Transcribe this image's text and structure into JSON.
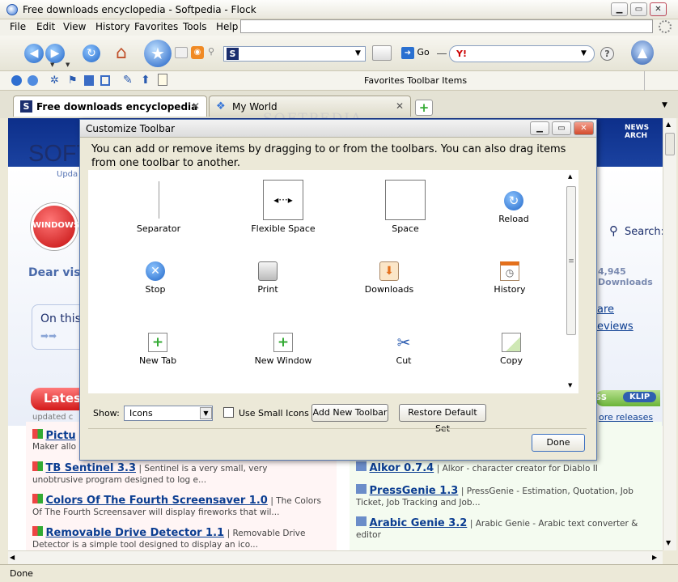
{
  "window": {
    "title": "Free downloads encyclopedia - Softpedia - Flock"
  },
  "menu": [
    "File",
    "Edit",
    "View",
    "History",
    "Favorites",
    "Tools",
    "Help"
  ],
  "nav": {
    "go_label": "Go",
    "search_logo": "Y!"
  },
  "favbar": {
    "label": "Favorites Toolbar Items"
  },
  "tabs": [
    {
      "label": "Free downloads encyclopedia ..."
    },
    {
      "label": "My World"
    }
  ],
  "page": {
    "watermark": "SOFTPEDIA",
    "logo": "SOFT",
    "update_snippet": "Upda",
    "news_archive": "NEWS ARCH",
    "windows_badge": "WINDOWS",
    "dear_visitor": "Dear visito",
    "downloads_count": "4,945 Downloads",
    "search_label": "Search:",
    "on_this": "On this p",
    "more_link": "are",
    "reviews_link": "eviews",
    "latest": "Latest",
    "updated": "updated c",
    "klip": "KLIP",
    "ss": "SS",
    "more_releases": "ore releases",
    "left_items": [
      {
        "title": "Pictu",
        "desc": "Maker allo"
      },
      {
        "title": "TB Sentinel 3.3",
        "desc": "| Sentinel is a very small, very unobtrusive program designed to log e..."
      },
      {
        "title": "Colors Of The Fourth Screensaver 1.0",
        "desc": "| The Colors Of The Fourth Screensaver will display fireworks that wil..."
      },
      {
        "title": "Removable Drive Detector 1.1",
        "desc": "| Removable Drive Detector is a simple tool designed to display an ico..."
      }
    ],
    "right_items": [
      {
        "title": "Alkor 0.7.4",
        "desc": "| Alkor - character creator for Diablo II"
      },
      {
        "title": "PressGenie 1.3",
        "desc": "| PressGenie - Estimation, Quotation, Job Ticket, Job Tracking and Job..."
      },
      {
        "title": "Arabic Genie 3.2",
        "desc": "| Arabic Genie - Arabic text converter & editor"
      }
    ]
  },
  "dialog": {
    "title": "Customize Toolbar",
    "message": "You can add or remove items by dragging to or from the toolbars. You can also drag items from one toolbar to another.",
    "items": [
      "Separator",
      "Flexible Space",
      "Space",
      "Reload",
      "Stop",
      "Print",
      "Downloads",
      "History",
      "New Tab",
      "New Window",
      "Cut",
      "Copy"
    ],
    "show_label": "Show:",
    "show_value": "Icons",
    "small_icons_label": "Use Small Icons",
    "add_toolbar": "Add New Toolbar",
    "restore": "Restore Default Set",
    "done": "Done"
  },
  "status": {
    "text": "Done"
  }
}
